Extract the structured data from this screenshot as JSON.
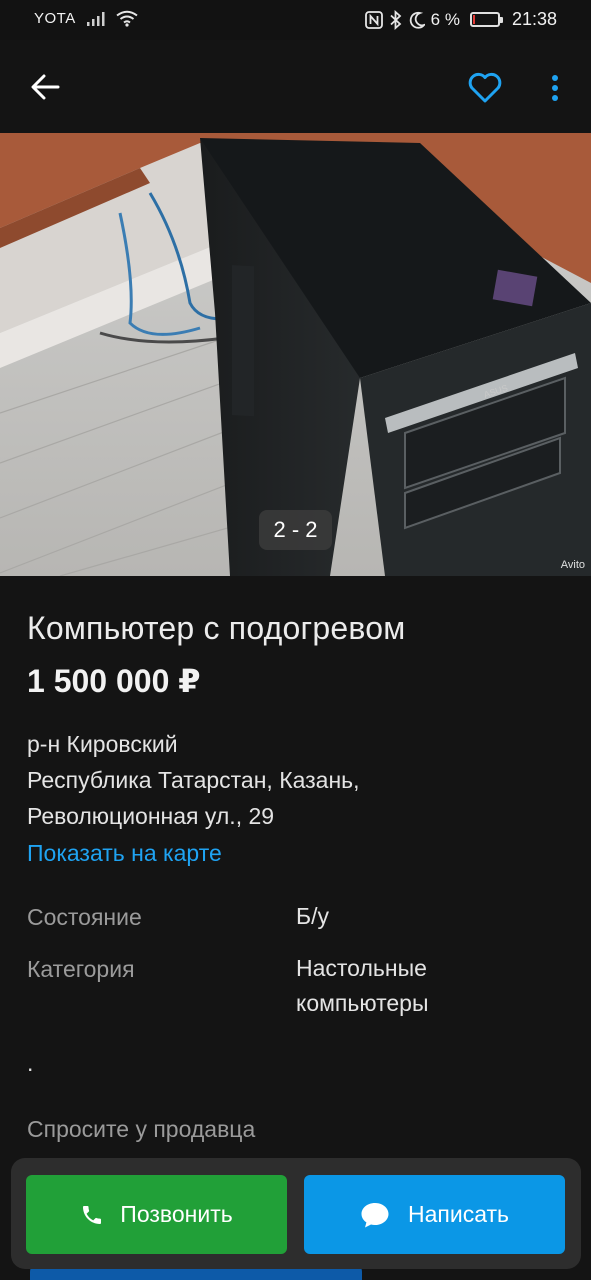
{
  "status_bar": {
    "carrier": "YOTA",
    "battery_percent": "6 %",
    "battery_level": 0.06,
    "time": "21:38"
  },
  "toolbar": {
    "back_icon": "arrow-left-icon",
    "favorite_icon": "heart-outline-icon",
    "menu_icon": "more-vertical-icon",
    "accent_color": "#1fa3f2"
  },
  "gallery": {
    "counter": "2 - 2",
    "watermark": "Avito"
  },
  "listing": {
    "title": "Компьютер с подогревом",
    "price": "1 500 000 ₽",
    "address_lines": [
      "р-н Кировский",
      "Республика Татарстан, Казань,",
      "Революционная ул., 29"
    ],
    "map_link": "Показать на карте",
    "params": [
      {
        "label": "Состояние",
        "value": "Б/у"
      },
      {
        "label": "Категория",
        "value": "Настольные компьютеры"
      }
    ],
    "description": ".",
    "ask_title": "Спросите у продавца"
  },
  "actions": {
    "call_label": "Позвонить",
    "message_label": "Написать",
    "call_color": "#21a038",
    "message_color": "#0b97e6"
  }
}
